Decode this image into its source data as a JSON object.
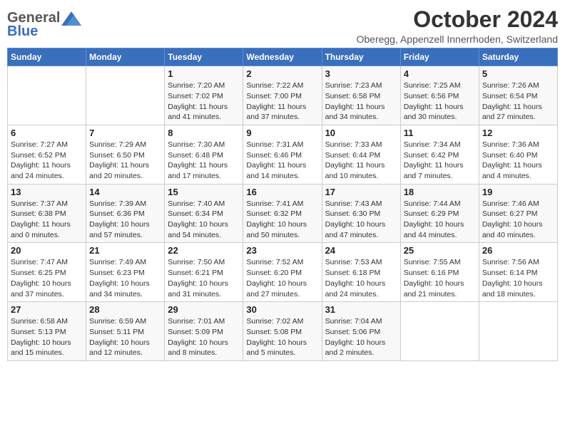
{
  "logo": {
    "general": "General",
    "blue": "Blue"
  },
  "title": "October 2024",
  "subtitle": "Oberegg, Appenzell Innerrhoden, Switzerland",
  "days_of_week": [
    "Sunday",
    "Monday",
    "Tuesday",
    "Wednesday",
    "Thursday",
    "Friday",
    "Saturday"
  ],
  "weeks": [
    [
      {
        "day": "",
        "sunrise": "",
        "sunset": "",
        "daylight": ""
      },
      {
        "day": "",
        "sunrise": "",
        "sunset": "",
        "daylight": ""
      },
      {
        "day": "1",
        "sunrise": "Sunrise: 7:20 AM",
        "sunset": "Sunset: 7:02 PM",
        "daylight": "Daylight: 11 hours and 41 minutes."
      },
      {
        "day": "2",
        "sunrise": "Sunrise: 7:22 AM",
        "sunset": "Sunset: 7:00 PM",
        "daylight": "Daylight: 11 hours and 37 minutes."
      },
      {
        "day": "3",
        "sunrise": "Sunrise: 7:23 AM",
        "sunset": "Sunset: 6:58 PM",
        "daylight": "Daylight: 11 hours and 34 minutes."
      },
      {
        "day": "4",
        "sunrise": "Sunrise: 7:25 AM",
        "sunset": "Sunset: 6:56 PM",
        "daylight": "Daylight: 11 hours and 30 minutes."
      },
      {
        "day": "5",
        "sunrise": "Sunrise: 7:26 AM",
        "sunset": "Sunset: 6:54 PM",
        "daylight": "Daylight: 11 hours and 27 minutes."
      }
    ],
    [
      {
        "day": "6",
        "sunrise": "Sunrise: 7:27 AM",
        "sunset": "Sunset: 6:52 PM",
        "daylight": "Daylight: 11 hours and 24 minutes."
      },
      {
        "day": "7",
        "sunrise": "Sunrise: 7:29 AM",
        "sunset": "Sunset: 6:50 PM",
        "daylight": "Daylight: 11 hours and 20 minutes."
      },
      {
        "day": "8",
        "sunrise": "Sunrise: 7:30 AM",
        "sunset": "Sunset: 6:48 PM",
        "daylight": "Daylight: 11 hours and 17 minutes."
      },
      {
        "day": "9",
        "sunrise": "Sunrise: 7:31 AM",
        "sunset": "Sunset: 6:46 PM",
        "daylight": "Daylight: 11 hours and 14 minutes."
      },
      {
        "day": "10",
        "sunrise": "Sunrise: 7:33 AM",
        "sunset": "Sunset: 6:44 PM",
        "daylight": "Daylight: 11 hours and 10 minutes."
      },
      {
        "day": "11",
        "sunrise": "Sunrise: 7:34 AM",
        "sunset": "Sunset: 6:42 PM",
        "daylight": "Daylight: 11 hours and 7 minutes."
      },
      {
        "day": "12",
        "sunrise": "Sunrise: 7:36 AM",
        "sunset": "Sunset: 6:40 PM",
        "daylight": "Daylight: 11 hours and 4 minutes."
      }
    ],
    [
      {
        "day": "13",
        "sunrise": "Sunrise: 7:37 AM",
        "sunset": "Sunset: 6:38 PM",
        "daylight": "Daylight: 11 hours and 0 minutes."
      },
      {
        "day": "14",
        "sunrise": "Sunrise: 7:39 AM",
        "sunset": "Sunset: 6:36 PM",
        "daylight": "Daylight: 10 hours and 57 minutes."
      },
      {
        "day": "15",
        "sunrise": "Sunrise: 7:40 AM",
        "sunset": "Sunset: 6:34 PM",
        "daylight": "Daylight: 10 hours and 54 minutes."
      },
      {
        "day": "16",
        "sunrise": "Sunrise: 7:41 AM",
        "sunset": "Sunset: 6:32 PM",
        "daylight": "Daylight: 10 hours and 50 minutes."
      },
      {
        "day": "17",
        "sunrise": "Sunrise: 7:43 AM",
        "sunset": "Sunset: 6:30 PM",
        "daylight": "Daylight: 10 hours and 47 minutes."
      },
      {
        "day": "18",
        "sunrise": "Sunrise: 7:44 AM",
        "sunset": "Sunset: 6:29 PM",
        "daylight": "Daylight: 10 hours and 44 minutes."
      },
      {
        "day": "19",
        "sunrise": "Sunrise: 7:46 AM",
        "sunset": "Sunset: 6:27 PM",
        "daylight": "Daylight: 10 hours and 40 minutes."
      }
    ],
    [
      {
        "day": "20",
        "sunrise": "Sunrise: 7:47 AM",
        "sunset": "Sunset: 6:25 PM",
        "daylight": "Daylight: 10 hours and 37 minutes."
      },
      {
        "day": "21",
        "sunrise": "Sunrise: 7:49 AM",
        "sunset": "Sunset: 6:23 PM",
        "daylight": "Daylight: 10 hours and 34 minutes."
      },
      {
        "day": "22",
        "sunrise": "Sunrise: 7:50 AM",
        "sunset": "Sunset: 6:21 PM",
        "daylight": "Daylight: 10 hours and 31 minutes."
      },
      {
        "day": "23",
        "sunrise": "Sunrise: 7:52 AM",
        "sunset": "Sunset: 6:20 PM",
        "daylight": "Daylight: 10 hours and 27 minutes."
      },
      {
        "day": "24",
        "sunrise": "Sunrise: 7:53 AM",
        "sunset": "Sunset: 6:18 PM",
        "daylight": "Daylight: 10 hours and 24 minutes."
      },
      {
        "day": "25",
        "sunrise": "Sunrise: 7:55 AM",
        "sunset": "Sunset: 6:16 PM",
        "daylight": "Daylight: 10 hours and 21 minutes."
      },
      {
        "day": "26",
        "sunrise": "Sunrise: 7:56 AM",
        "sunset": "Sunset: 6:14 PM",
        "daylight": "Daylight: 10 hours and 18 minutes."
      }
    ],
    [
      {
        "day": "27",
        "sunrise": "Sunrise: 6:58 AM",
        "sunset": "Sunset: 5:13 PM",
        "daylight": "Daylight: 10 hours and 15 minutes."
      },
      {
        "day": "28",
        "sunrise": "Sunrise: 6:59 AM",
        "sunset": "Sunset: 5:11 PM",
        "daylight": "Daylight: 10 hours and 12 minutes."
      },
      {
        "day": "29",
        "sunrise": "Sunrise: 7:01 AM",
        "sunset": "Sunset: 5:09 PM",
        "daylight": "Daylight: 10 hours and 8 minutes."
      },
      {
        "day": "30",
        "sunrise": "Sunrise: 7:02 AM",
        "sunset": "Sunset: 5:08 PM",
        "daylight": "Daylight: 10 hours and 5 minutes."
      },
      {
        "day": "31",
        "sunrise": "Sunrise: 7:04 AM",
        "sunset": "Sunset: 5:06 PM",
        "daylight": "Daylight: 10 hours and 2 minutes."
      },
      {
        "day": "",
        "sunrise": "",
        "sunset": "",
        "daylight": ""
      },
      {
        "day": "",
        "sunrise": "",
        "sunset": "",
        "daylight": ""
      }
    ]
  ]
}
